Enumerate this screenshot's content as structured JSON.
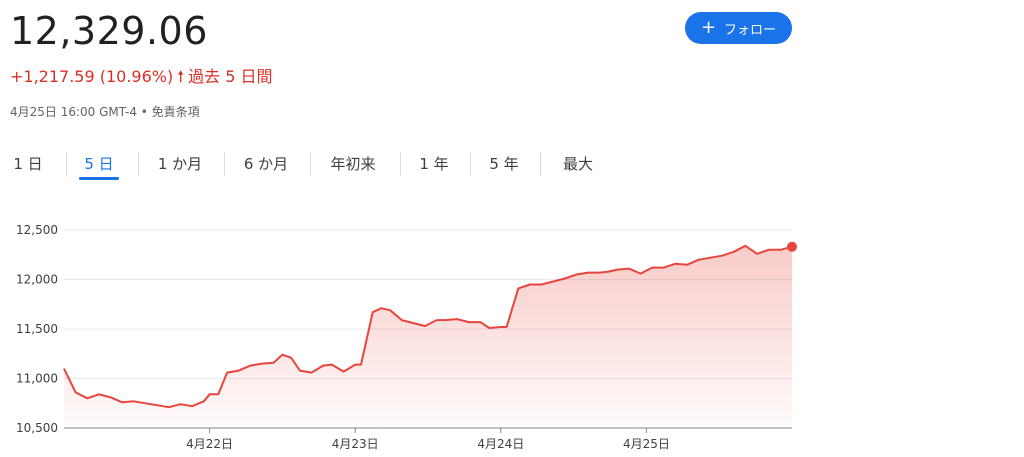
{
  "quote": {
    "price": "12,329.06",
    "change": "+1,217.59 (10.96%)",
    "period": "過去 5 日間",
    "timestamp": "4月25日 16:00 GMT-4 • 免責条項"
  },
  "follow_button": {
    "label": "フォロー"
  },
  "tabs": [
    {
      "label": "1 日",
      "active": false
    },
    {
      "label": "5 日",
      "active": true
    },
    {
      "label": "1 か月",
      "active": false
    },
    {
      "label": "6 か月",
      "active": false
    },
    {
      "label": "年初来",
      "active": false
    },
    {
      "label": "1 年",
      "active": false
    },
    {
      "label": "5 年",
      "active": false
    },
    {
      "label": "最大",
      "active": false
    }
  ],
  "colors": {
    "accent": "#1a73e8",
    "negative_positive_red": "#d93025",
    "line": "#e8453c"
  },
  "chart_data": {
    "type": "area",
    "title": "",
    "xlabel": "",
    "ylabel": "",
    "ylim": [
      10500,
      12500
    ],
    "yticks": [
      10500,
      11000,
      11500,
      12000,
      12500
    ],
    "ytick_labels": [
      "10,500",
      "11,000",
      "11,500",
      "12,000",
      "12,500"
    ],
    "xlim": [
      0,
      5
    ],
    "xticks": [
      1,
      2,
      3,
      4
    ],
    "xtick_labels": [
      "4月22日",
      "4月23日",
      "4月24日",
      "4月25日"
    ],
    "grid": true,
    "series": [
      {
        "x": [
          0.0,
          0.08,
          0.16,
          0.24,
          0.32,
          0.4,
          0.48,
          0.56,
          0.64,
          0.72,
          0.8,
          0.88,
          0.96,
          1.0,
          1.06,
          1.12,
          1.2,
          1.28,
          1.36,
          1.44,
          1.5,
          1.56,
          1.62,
          1.7,
          1.78,
          1.84,
          1.92,
          2.0,
          2.04,
          2.12,
          2.18,
          2.24,
          2.32,
          2.4,
          2.48,
          2.56,
          2.62,
          2.7,
          2.78,
          2.86,
          2.92,
          3.0,
          3.04,
          3.12,
          3.2,
          3.28,
          3.36,
          3.44,
          3.52,
          3.6,
          3.68,
          3.74,
          3.8,
          3.88,
          3.96,
          4.04,
          4.12,
          4.2,
          4.28,
          4.36,
          4.44,
          4.52,
          4.6,
          4.68,
          4.76,
          4.84,
          4.92,
          5.0
        ],
        "values": [
          11100,
          10860,
          10800,
          10840,
          10810,
          10760,
          10770,
          10750,
          10730,
          10710,
          10740,
          10720,
          10770,
          10840,
          10840,
          11060,
          11080,
          11130,
          11150,
          11160,
          11240,
          11210,
          11080,
          11060,
          11130,
          11140,
          11070,
          11140,
          11140,
          11670,
          11710,
          11690,
          11590,
          11560,
          11530,
          11590,
          11590,
          11600,
          11570,
          11570,
          11510,
          11520,
          11520,
          11910,
          11950,
          11950,
          11980,
          12010,
          12050,
          12070,
          12070,
          12080,
          12100,
          12110,
          12060,
          12120,
          12120,
          12160,
          12150,
          12200,
          12220,
          12240,
          12280,
          12340,
          12260,
          12300,
          12300,
          12330
        ]
      }
    ]
  }
}
